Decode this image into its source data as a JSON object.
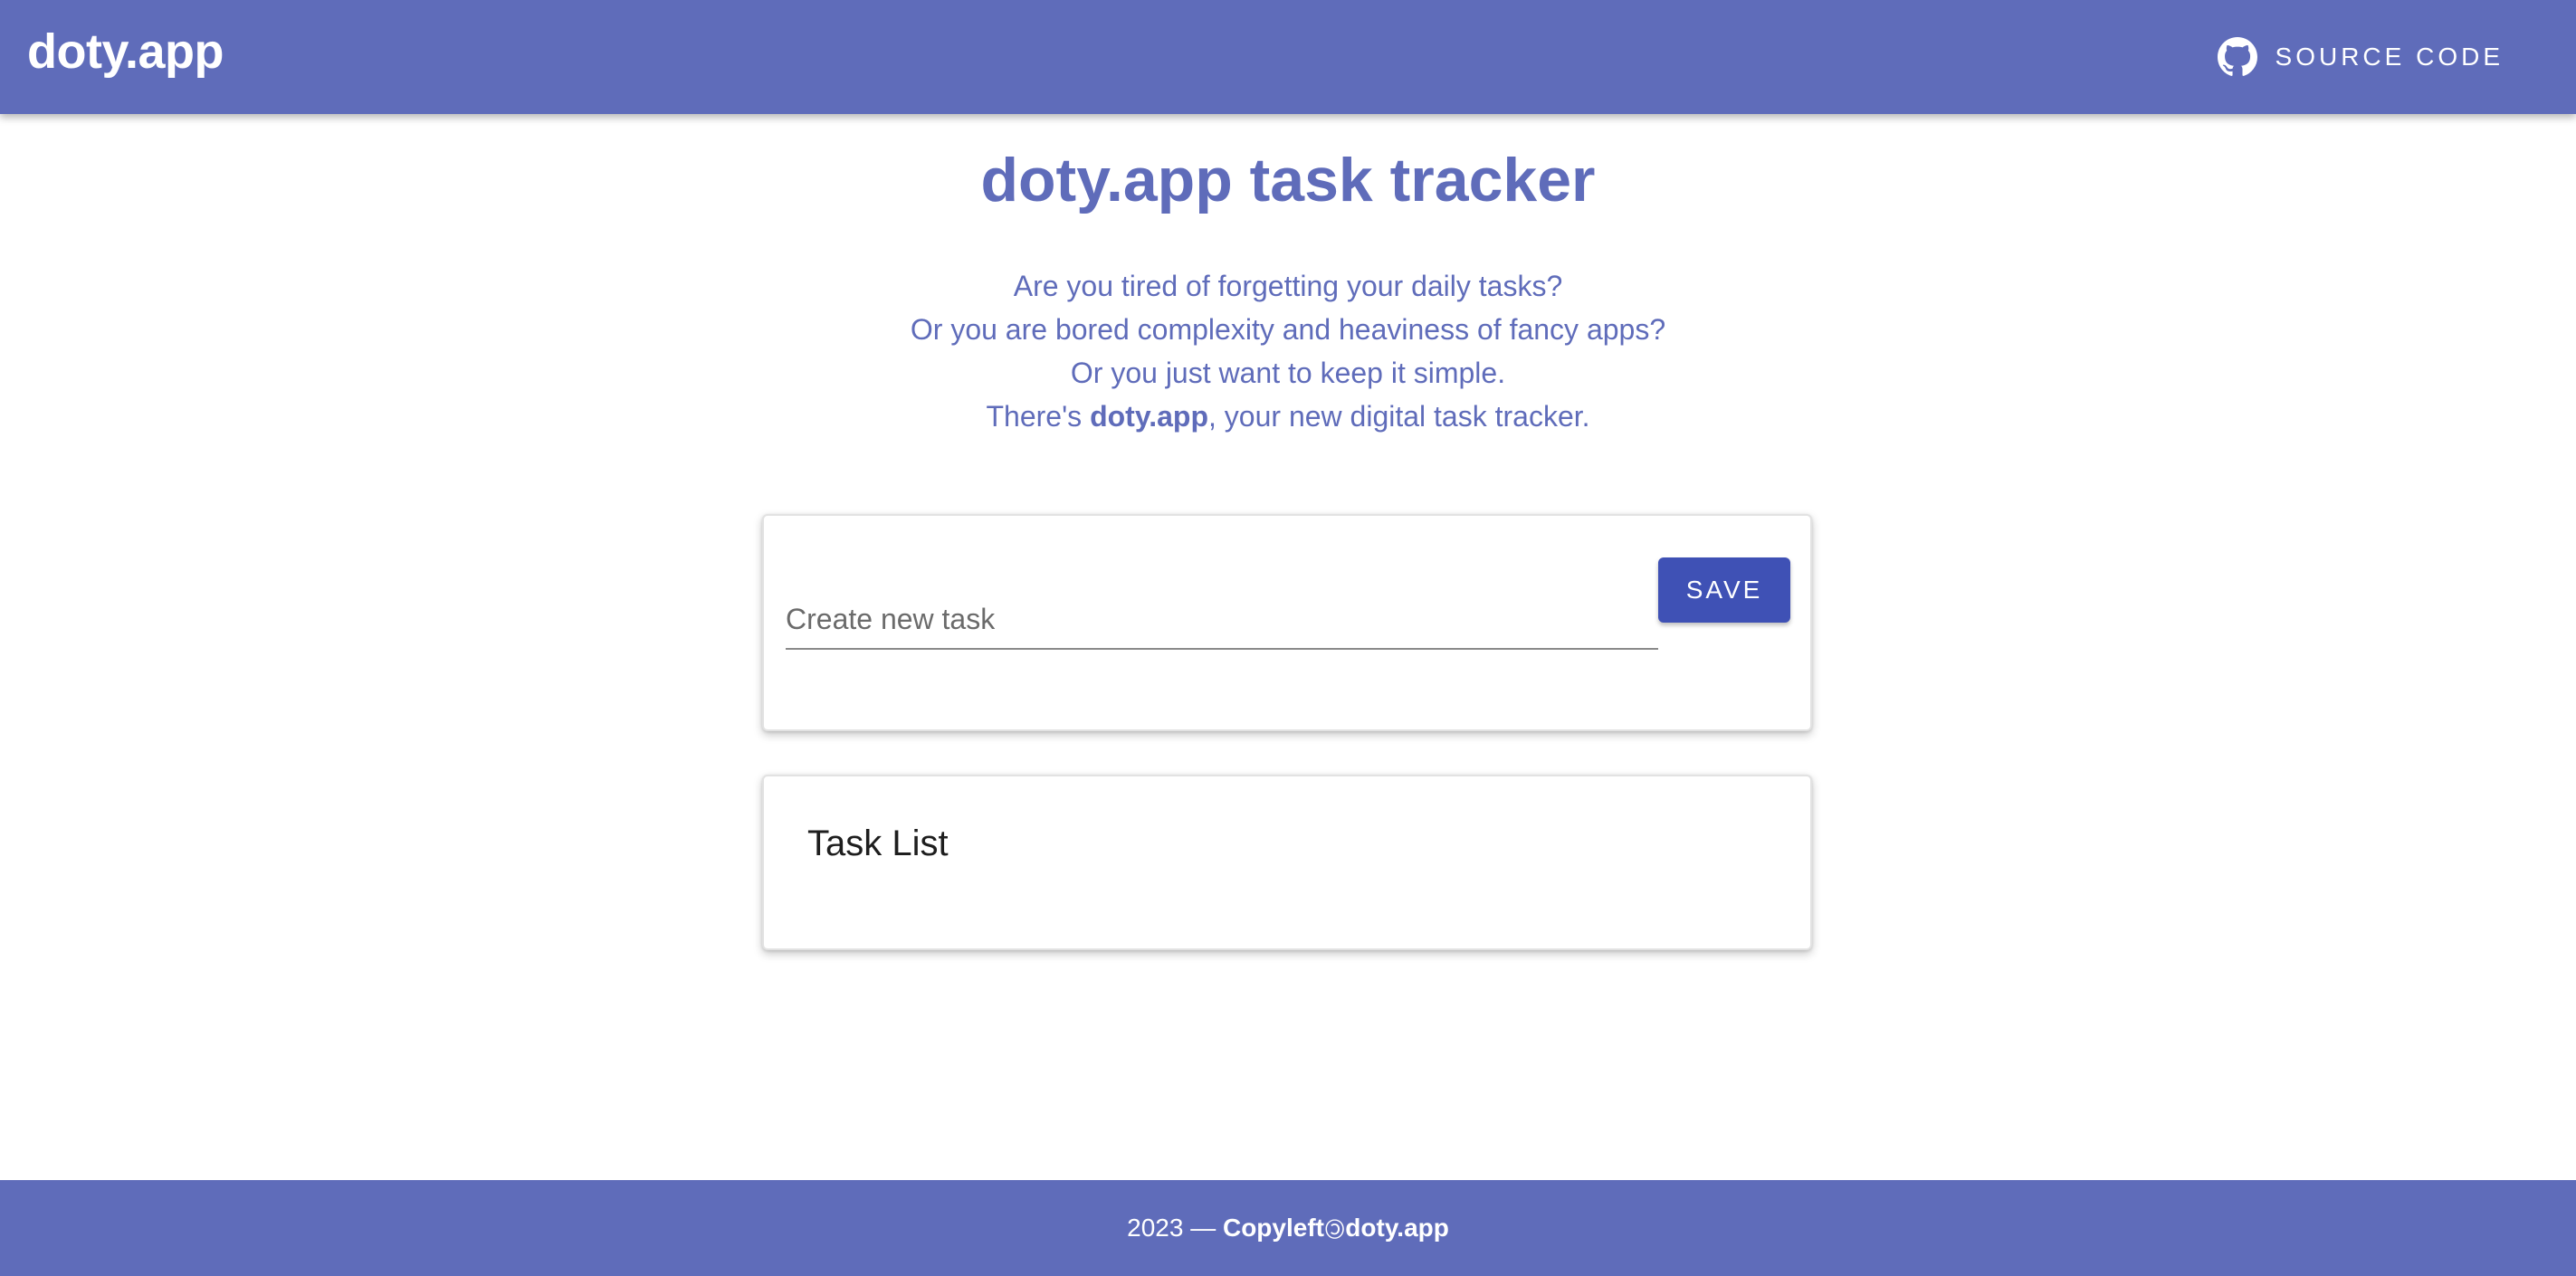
{
  "appbar": {
    "brand": "doty.app",
    "source_code_label": "Source Code",
    "source_code_icon": "github-icon",
    "background_color": "#5f6cba"
  },
  "main": {
    "title": "doty.app task tracker",
    "intro": {
      "line1": "Are you tired of forgetting your daily tasks?",
      "line2": "Or you are bored complexity and heaviness of fancy apps?",
      "line3": "Or you just want to keep it simple.",
      "line4_prefix": "There's ",
      "line4_brand": "doty.app",
      "line4_suffix": ", your new digital task tracker."
    },
    "create_task": {
      "placeholder": "Create new task",
      "value": "",
      "save_label": "SAVE",
      "save_color": "#3f51b5"
    },
    "task_list": {
      "title": "Task List",
      "items": []
    }
  },
  "footer": {
    "year_prefix": "2023 — ",
    "copyleft": "Copyleft ",
    "copyleft_symbol": "🄯",
    "brand": " doty.app"
  }
}
